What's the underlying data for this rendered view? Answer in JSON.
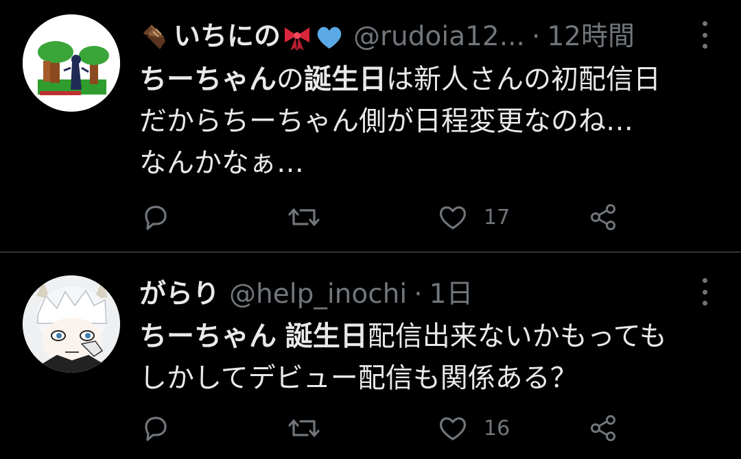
{
  "tweets": [
    {
      "name": "いちにの",
      "name_emojis": [
        "coffin-emoji",
        "ribbon-emoji",
        "blue-heart-emoji"
      ],
      "handle": "@rudoia12...",
      "separator": "·",
      "time": "12時間",
      "body_lines": [
        [
          {
            "text": "ちーちゃん",
            "bold": true
          },
          {
            "text": "の",
            "bold": false
          },
          {
            "text": "誕生日",
            "bold": true
          },
          {
            "text": "は新人さんの初配信日",
            "bold": false
          }
        ],
        [
          {
            "text": "だからちーちゃん側が日程変更なのね…",
            "bold": false
          }
        ],
        [
          {
            "text": "なんかなぁ…",
            "bold": false
          }
        ]
      ],
      "like_count": "17"
    },
    {
      "name": "がらり",
      "handle": "@help_inochi",
      "separator": "·",
      "time": "1日",
      "body_lines": [
        [
          {
            "text": "ちーちゃん",
            "bold": true
          },
          {
            "text": " ",
            "bold": false
          },
          {
            "text": "誕生日",
            "bold": true
          },
          {
            "text": "配信出来ないかもっても",
            "bold": false
          }
        ],
        [
          {
            "text": "しかしてデビュー配信も関係ある？",
            "bold": false
          }
        ]
      ],
      "like_count": "16"
    }
  ],
  "icons": [
    "reply-icon",
    "retweet-icon",
    "like-icon",
    "share-icon",
    "more-icon"
  ],
  "colors": {
    "background": "#000000",
    "text_primary": "#e7e9ea",
    "text_secondary": "#71767b",
    "divider": "#2f3336",
    "blue_heart": "#5aa9e6",
    "ribbon": "#d9263b"
  }
}
